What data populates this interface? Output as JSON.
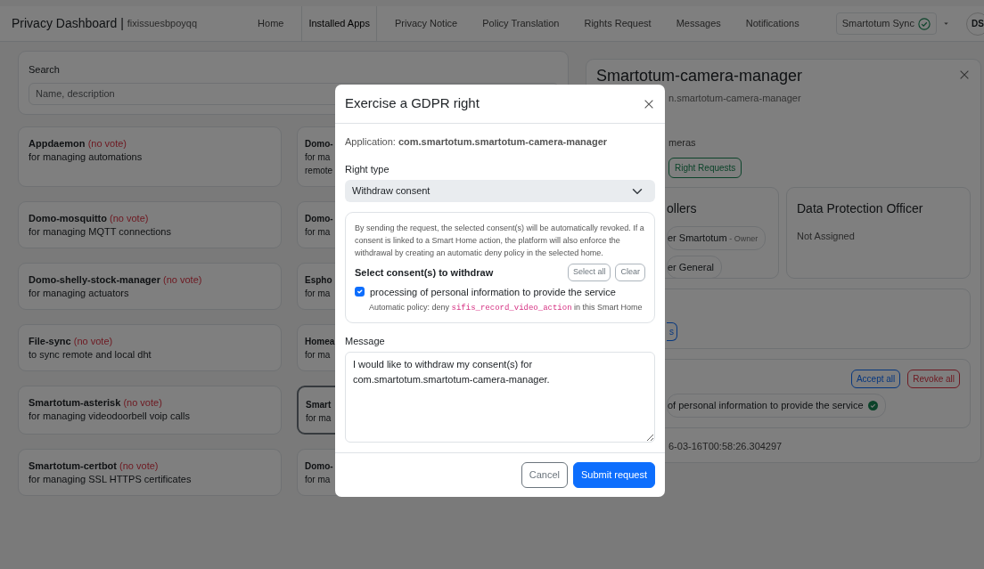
{
  "navbar": {
    "brand": "Privacy Dashboard |",
    "user_tag": "fixissuesbpoyqq",
    "links": [
      {
        "label": "Home",
        "selected": false
      },
      {
        "label": "Installed Apps",
        "selected": true
      },
      {
        "label": "Privacy Notice",
        "selected": false
      },
      {
        "label": "Policy Translation",
        "selected": false
      },
      {
        "label": "Rights Request",
        "selected": false
      },
      {
        "label": "Messages",
        "selected": false
      },
      {
        "label": "Notifications",
        "selected": false
      }
    ],
    "sync": {
      "label": "Smartotum Sync",
      "synced": true
    },
    "avatar": "DS"
  },
  "search": {
    "label": "Search",
    "placeholder": "Name, description"
  },
  "apps_left": [
    {
      "name": "Appdaemon",
      "vote": "(no vote)",
      "description": "for managing automations",
      "selected": false
    },
    {
      "name": "Domo-mosquitto",
      "vote": "(no vote)",
      "description": "for managing MQTT connections",
      "selected": false
    },
    {
      "name": "Domo-shelly-stock-manager",
      "vote": "(no vote)",
      "description": "for managing actuators",
      "selected": false
    },
    {
      "name": "File-sync",
      "vote": "(no vote)",
      "description": "to sync remote and local dht",
      "selected": false
    },
    {
      "name": "Smartotum-asterisk",
      "vote": "(no vote)",
      "description": "for managing videodoorbell voip calls",
      "selected": false
    },
    {
      "name": "Smartotum-certbot",
      "vote": "(no vote)",
      "description": "for managing SSL HTTPS certificates",
      "selected": false
    }
  ],
  "apps_right": [
    {
      "name": "Domo-",
      "lines": [
        "for ma",
        "remote"
      ],
      "selected": false
    },
    {
      "name": "Domo-",
      "lines": [
        "for ma"
      ],
      "selected": false
    },
    {
      "name": "Espho",
      "lines": [
        "for ma"
      ],
      "selected": false
    },
    {
      "name": "Homea",
      "lines": [
        "for ma"
      ],
      "selected": false
    },
    {
      "name": "Smart",
      "lines": [
        "for ma"
      ],
      "selected": true
    },
    {
      "name": "Domo-",
      "lines": [
        "for ma"
      ],
      "selected": false
    }
  ],
  "detail": {
    "title": "Smartotum-camera-manager",
    "subtitle": "n.smartotum-camera-manager",
    "description": "meras",
    "actions": [
      {
        "label": "Right Requests"
      }
    ],
    "controllers": {
      "heading": "ollers",
      "entries": [
        {
          "name": "er Smartotum",
          "role": "- Owner"
        },
        {
          "name": "er General"
        }
      ]
    },
    "dpo": {
      "heading": "Data Protection Officer",
      "value": "Not Assigned"
    },
    "rights_buttons": [
      {
        "label": "s"
      }
    ],
    "consent_buttons": [
      {
        "label": "Accept all",
        "kind": "accept"
      },
      {
        "label": "Revoke all",
        "kind": "revoke"
      }
    ],
    "consents": [
      {
        "label": "of personal information to provide the service",
        "granted": true
      }
    ],
    "timestamp": "6-03-16T00:58:26.304297"
  },
  "modal": {
    "title": "Exercise a GDPR right",
    "application": "Application: **com.smartotum.smartotum-camera-manager**",
    "right_type": {
      "label": "Right type",
      "value": "Withdraw consent"
    },
    "info": "By sending the request, the selected consent(s) will be automatically revoked. If a consent is linked to a Smart Home action, the platform will also enforce the withdrawal by creating an automatic deny policy in the selected home.",
    "consent_heading": "Select consent(s) to withdraw",
    "consent_buttons": [
      "Select all",
      "Clear"
    ],
    "consents": [
      {
        "label": "processing of personal information to provide the service",
        "checked": true,
        "policy_prefix": "Automatic policy: deny",
        "action": "sifis_record_video_action",
        "policy_suffix": "in this Smart Home"
      }
    ],
    "message": {
      "label": "Message",
      "value": "I would like to withdraw my consent(s) for com.smartotum.smartotum-camera-manager."
    },
    "footer_buttons": [
      {
        "label": "Cancel",
        "kind": "secondary"
      },
      {
        "label": "Submit request",
        "kind": "primary"
      }
    ]
  }
}
